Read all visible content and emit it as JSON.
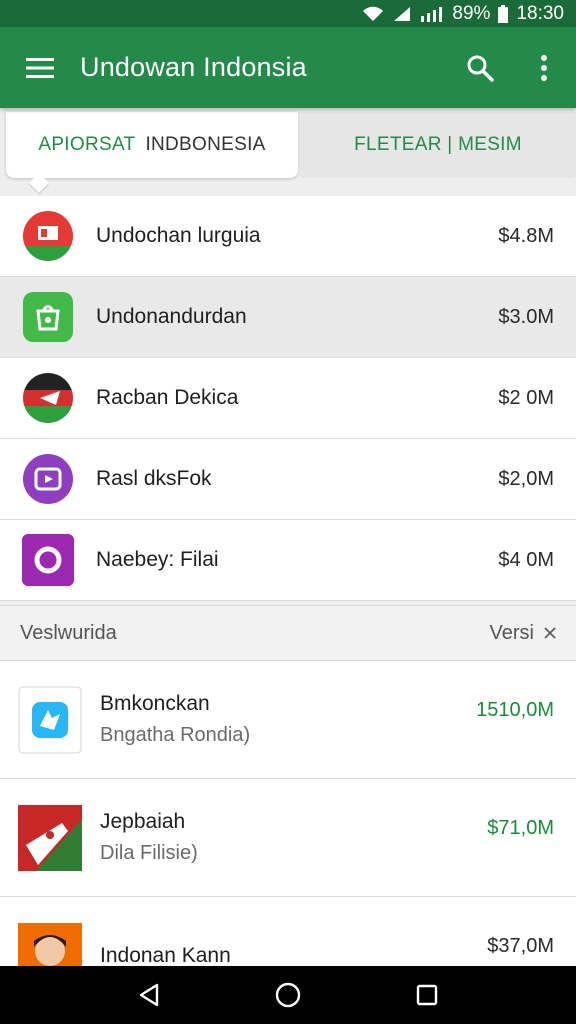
{
  "status_bar": {
    "battery": "89%",
    "time": "18:30"
  },
  "app_bar": {
    "title": "Undowan Indonsia"
  },
  "tabs": {
    "active_green": "APIORSAT",
    "active_dark": "INDBONESIA",
    "inactive": "FLETEAR | MESIM"
  },
  "list": [
    {
      "name": "Undochan lurguia",
      "price": "$4.8M",
      "icon": "red-flag-app-icon",
      "color": "#e53935"
    },
    {
      "name": "Undonandurdan",
      "price": "$3.0M",
      "icon": "green-bag-app-icon",
      "color": "#43b94a"
    },
    {
      "name": "Racban Dekica",
      "price": "$2 0M",
      "icon": "black-red-flag-icon",
      "color": "#d32f2f"
    },
    {
      "name": "Rasl dksFok",
      "price": "$2,0M",
      "icon": "purple-media-icon",
      "color": "#8e3fc0"
    },
    {
      "name": "Naebey: Filai",
      "price": "$4 0M",
      "icon": "purple-circle-icon",
      "color": "#9c27b0"
    }
  ],
  "section": {
    "left": "Veslwurida",
    "right": "Versi"
  },
  "list2": [
    {
      "title": "Bmkonckan",
      "subtitle": "Bngatha Rondia)",
      "price": "1510,0M",
      "icon": "blue-app-icon"
    },
    {
      "title": "Jepbaiah",
      "subtitle": "Dila Filisie)",
      "price": "$71,0M",
      "icon": "green-red-flag-icon"
    },
    {
      "title": "Indonan Kann",
      "subtitle": "",
      "price": "$37,0M",
      "icon": "person-avatar-icon"
    }
  ]
}
